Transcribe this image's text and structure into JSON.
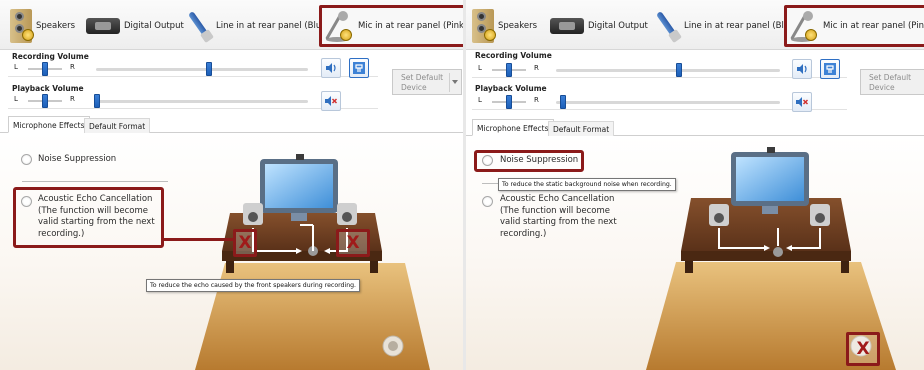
{
  "colors": {
    "highlight": "#8b1a1a",
    "slider_thumb": "#1c5fb8",
    "floor_light": "#e3b56a",
    "floor_dark": "#b87a2e",
    "desk": "#6a3d22",
    "x_mark": "#a01a1a"
  },
  "panels": [
    {
      "id": "left",
      "tabs": [
        {
          "label": "Speakers",
          "icon": "speaker-icon"
        },
        {
          "label": "Digital Output",
          "icon": "digital-output-icon"
        },
        {
          "label": "Line in at rear panel (Blue)",
          "icon": "line-in-cable-icon"
        },
        {
          "label": "Mic in at rear panel (Pink)",
          "icon": "microphone-icon",
          "selected": true
        }
      ],
      "recording_volume_label": "Recording Volume",
      "playback_volume_label": "Playback Volume",
      "left_label": "L",
      "right_label": "R",
      "set_default_label": "Set Default Device",
      "subtabs": [
        "Microphone Effects",
        "Default Format"
      ],
      "options": {
        "noise_suppression": "Noise Suppression",
        "echo_cancellation": "Acoustic Echo Cancellation (The function will become valid starting from the next recording.)"
      },
      "tooltip": "To reduce the echo caused by the front speakers during recording.",
      "x_marks": [
        "X",
        "X"
      ]
    },
    {
      "id": "right",
      "tabs": [
        {
          "label": "Speakers",
          "icon": "speaker-icon"
        },
        {
          "label": "Digital Output",
          "icon": "digital-output-icon"
        },
        {
          "label": "Line in at rear panel (Blue)",
          "icon": "line-in-cable-icon"
        },
        {
          "label": "Mic in at rear panel (Pink)",
          "icon": "microphone-icon",
          "selected": true
        }
      ],
      "recording_volume_label": "Recording Volume",
      "playback_volume_label": "Playback Volume",
      "left_label": "L",
      "right_label": "R",
      "set_default_label": "Set Default Device",
      "subtabs": [
        "Microphone Effects",
        "Default Format"
      ],
      "options": {
        "noise_suppression": "Noise Suppression",
        "echo_cancellation": "Acoustic Echo Cancellation (The function will become valid starting from the next recording.)"
      },
      "tooltip": "To reduce the static background noise when recording.",
      "x_marks": [
        "X"
      ]
    }
  ]
}
